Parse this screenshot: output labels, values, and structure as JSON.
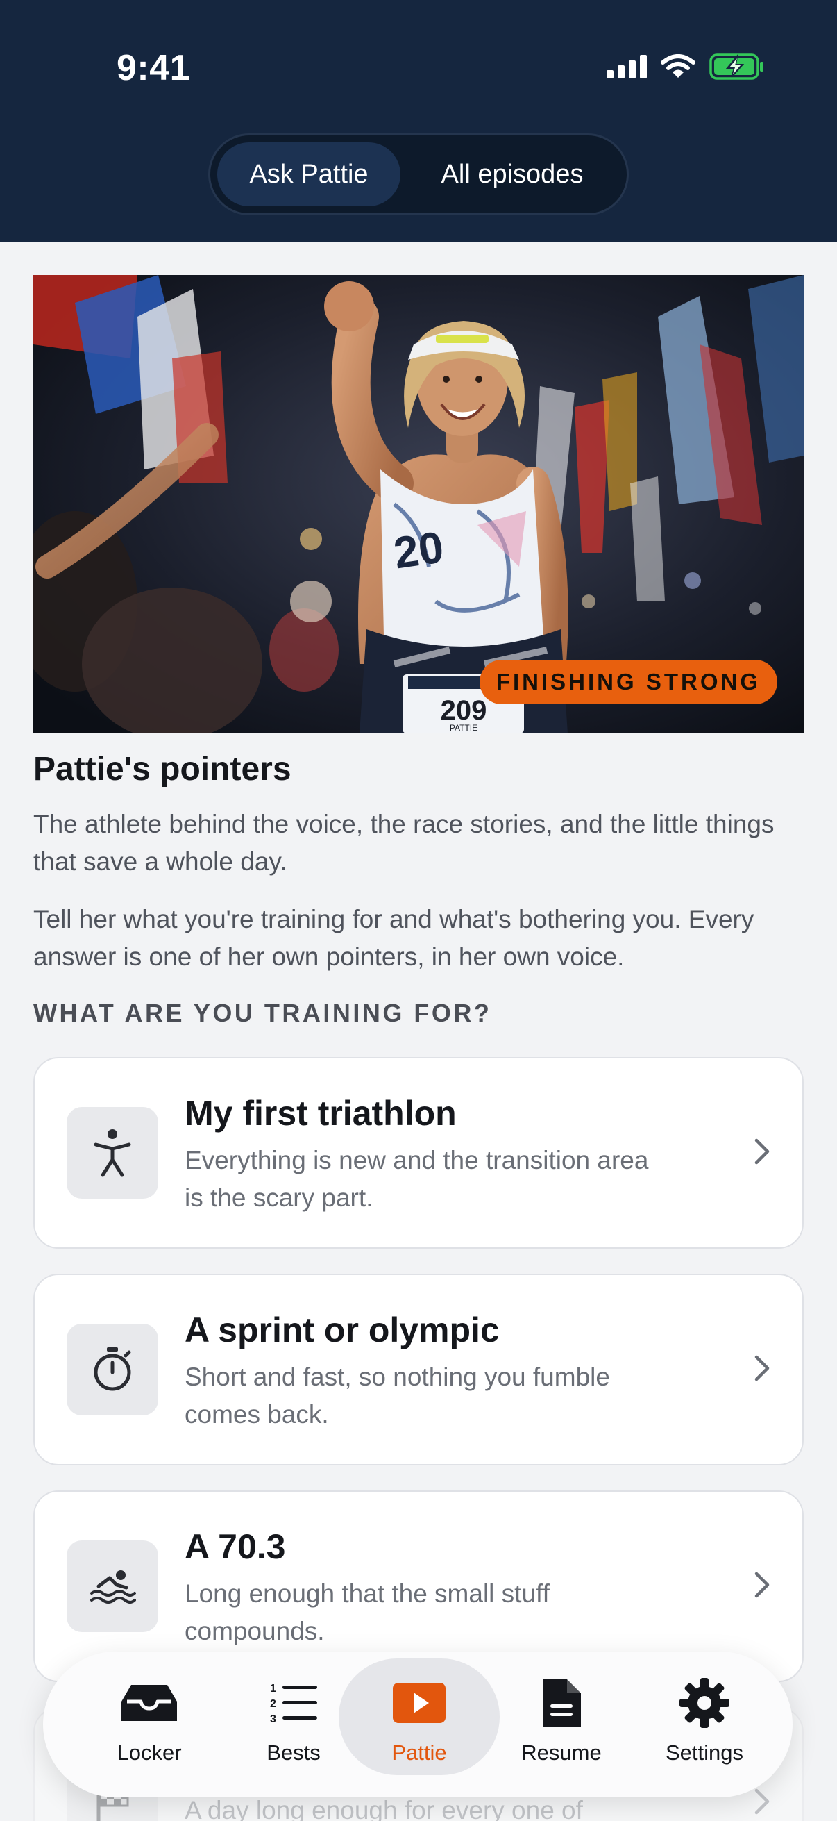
{
  "status": {
    "time": "9:41"
  },
  "segment": {
    "active": "Ask Pattie",
    "inactive": "All episodes"
  },
  "hero": {
    "badge": "FINISHING STRONG",
    "bib_number": "209",
    "bib_name": "PATTIE"
  },
  "content": {
    "title": "Pattie's pointers",
    "paragraph1": "The athlete behind the voice, the race stories, and the little things that save a whole day.",
    "paragraph2": "Tell her what you're training for and what's bothering you. Every answer is one of her own pointers, in her own voice.",
    "section_label": "WHAT ARE YOU TRAINING FOR?"
  },
  "cards": [
    {
      "icon": "person-icon",
      "title": "My first triathlon",
      "subtitle": "Everything is new and the transition area is the scary part."
    },
    {
      "icon": "stopwatch-icon",
      "title": "A sprint or olympic",
      "subtitle": "Short and fast, so nothing you fumble comes back."
    },
    {
      "icon": "swimmer-icon",
      "title": "A 70.3",
      "subtitle": "Long enough that the small stuff compounds."
    },
    {
      "icon": "checkered-flag-icon",
      "title": "",
      "subtitle": "A day long enough for every one of"
    }
  ],
  "tabs": [
    {
      "icon": "tray-icon",
      "label": "Locker"
    },
    {
      "icon": "numbered-list-icon",
      "label": "Bests"
    },
    {
      "icon": "play-icon",
      "label": "Pattie",
      "active": true
    },
    {
      "icon": "document-icon",
      "label": "Resume"
    },
    {
      "icon": "gear-icon",
      "label": "Settings"
    }
  ],
  "colors": {
    "header": "#15263f",
    "accent": "#e2560d",
    "badge": "#e8600e"
  }
}
